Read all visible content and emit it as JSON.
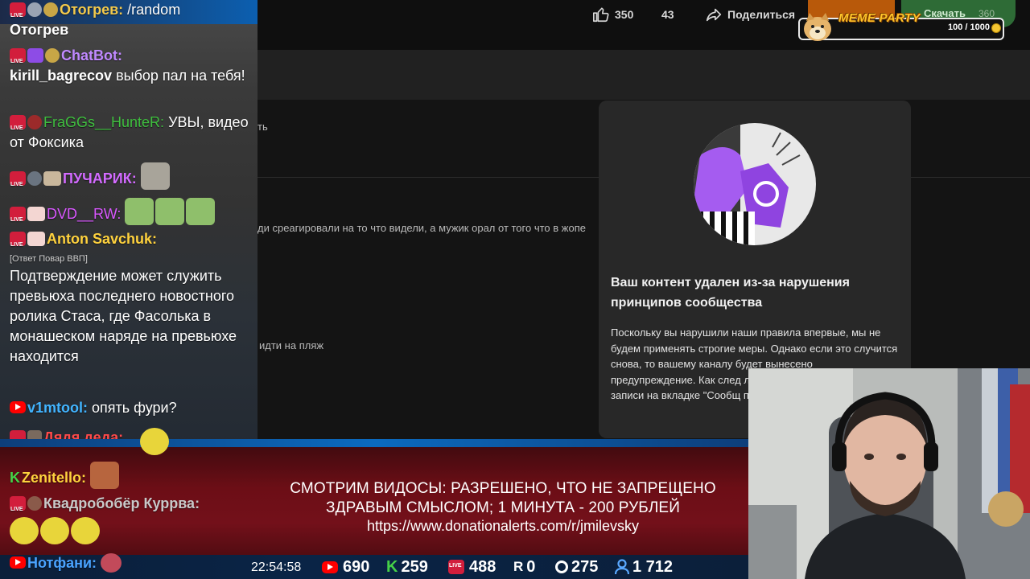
{
  "youtube": {
    "likes": "350",
    "dislikes": "43",
    "share_label": "Поделиться",
    "download_label": "Скачать",
    "download_count": "360",
    "ghost_text_1": "ть",
    "ghost_text_2": "ди среагировали на то что видели, а мужик орал от того что в жопе",
    "ghost_text_3": "идти на пляж"
  },
  "dialog": {
    "title": "Ваш контент удален из-за нарушения принципов сообщества",
    "body": "Поскольку вы нарушили наши правила впервые, мы не будем применять строгие меры. Однако если это случится снова, то вашему каналу будет вынесено предупреждение. Как след лишитесь возможности за записи на вкладке \"Сообщ прямые трансляции."
  },
  "meme_party": {
    "title": "MEME PARTY",
    "progress": "100 / 1000"
  },
  "chat": {
    "messages": [
      {
        "name": "Отогрев:",
        "text": "/random",
        "name_color": "#f2c94c"
      },
      {
        "name": "",
        "text": "Отогрев",
        "name_color": "#ffffff"
      },
      {
        "name": "ChatBot:",
        "text": "",
        "name_color": "#c089ff"
      },
      {
        "name": "kirill_bagrecov",
        "text": " выбор пал на тебя!",
        "name_color": "#ffffff"
      },
      {
        "name": "FraGGs__HunteR:",
        "text": " УВЫ, видео от Фоксика",
        "name_color": "#3fbf3f"
      },
      {
        "name": "ПУЧАРИК:",
        "text": "",
        "name_color": "#d36bff"
      },
      {
        "name": "DVD__RW:",
        "text": "",
        "name_color": "#d958ff"
      },
      {
        "name": "Anton Savchuk:",
        "text": "",
        "name_color": "#ffd23e"
      },
      {
        "name": "",
        "reply": "[Ответ Повар ВВП]",
        "text": "Подтверждение может служить превьюха последнего новостного ролика Стаса, где Фасолька в монашеском наряде на превьюхе находится",
        "name_color": "#ffffff"
      },
      {
        "name": "v1mtool:",
        "text": " опять фури?",
        "name_color": "#42b4ff"
      },
      {
        "name": "Дядя деда:",
        "text": "",
        "name_color": "#ff4a4a"
      },
      {
        "name": "Zenitello:",
        "text": "",
        "name_color": "#ffd23e"
      },
      {
        "name": "Квадробобёр Куррва:",
        "text": "",
        "name_color": "#c9c9c9"
      },
      {
        "name": "Нотфани:",
        "text": "",
        "name_color": "#4aa3ff"
      }
    ]
  },
  "overlay": {
    "rules_line_1": "СМОТРИМ ВИДОСЫ: РАЗРЕШЕНО, ЧТО НЕ ЗАПРЕЩЕНО",
    "rules_line_2": "ЗДРАВЫМ СМЫСЛОМ; 1 МИНУТА - 200 РУБЛЕЙ",
    "url": "https://www.donationalerts.com/r/jmilevsky",
    "clock": "22:54:58",
    "stats": {
      "youtube": "690",
      "kick": "259",
      "vk_live": "488",
      "rutube": "0",
      "trovo": "275",
      "total_viewers": "1 712"
    }
  },
  "colors": {
    "accent_live": "#d21e3c",
    "kick_green": "#45d148",
    "youtube_red": "#ff0000",
    "meme_gold": "#ffc52a"
  }
}
